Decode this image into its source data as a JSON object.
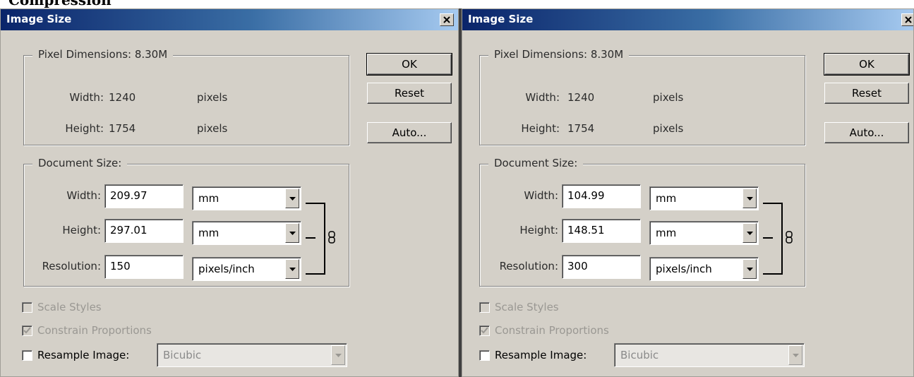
{
  "page": {
    "heading": "Compression"
  },
  "dialogs": [
    {
      "title": "Image Size",
      "close_glyph": "×",
      "pixel_dimensions": {
        "title": "Pixel Dimensions:  8.30M",
        "width_label": "Width:",
        "width_value": "1240",
        "width_unit": "pixels",
        "height_label": "Height:",
        "height_value": "1754",
        "height_unit": "pixels"
      },
      "buttons": {
        "ok": "OK",
        "reset": "Reset",
        "auto": "Auto..."
      },
      "document_size": {
        "title": "Document Size:",
        "width_label": "Width:",
        "width_value": "209.97",
        "width_unit": "mm",
        "height_label": "Height:",
        "height_value": "297.01",
        "height_unit": "mm",
        "resolution_label": "Resolution:",
        "resolution_value": "150",
        "resolution_unit": "pixels/inch"
      },
      "options": {
        "scale_styles": "Scale Styles",
        "constrain_proportions": "Constrain Proportions",
        "resample_image": "Resample Image:",
        "resample_method": "Bicubic"
      }
    },
    {
      "title": "Image Size",
      "close_glyph": "×",
      "pixel_dimensions": {
        "title": "Pixel Dimensions:  8.30M",
        "width_label": "Width:",
        "width_value": "1240",
        "width_unit": "pixels",
        "height_label": "Height:",
        "height_value": "1754",
        "height_unit": "pixels"
      },
      "buttons": {
        "ok": "OK",
        "reset": "Reset",
        "auto": "Auto..."
      },
      "document_size": {
        "title": "Document Size:",
        "width_label": "Width:",
        "width_value": "104.99",
        "width_unit": "mm",
        "height_label": "Height:",
        "height_value": "148.51",
        "height_unit": "mm",
        "resolution_label": "Resolution:",
        "resolution_value": "300",
        "resolution_unit": "pixels/inch"
      },
      "options": {
        "scale_styles": "Scale Styles",
        "constrain_proportions": "Constrain Proportions",
        "resample_image": "Resample Image:",
        "resample_method": "Bicubic"
      }
    }
  ]
}
